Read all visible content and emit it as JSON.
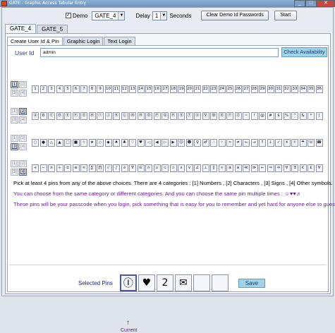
{
  "window": {
    "title": "GATE - Graphic Access Tabular Entry",
    "min": "_",
    "max": "□",
    "close": "✕"
  },
  "topbar": {
    "demo_checked": "✓",
    "demo_label": "Demo",
    "gate_value": "GATE_4",
    "delay_label": "Delay",
    "delay_value": "1",
    "seconds_label": "Seconds",
    "clear_btn": "Clear Demo Id Passwords",
    "start_btn": "Start"
  },
  "outer_tabs": [
    "GATE_4",
    "GATE_5"
  ],
  "inner_tabs": [
    "Create User Id & Pin",
    "Graphic Login",
    "Text Login"
  ],
  "form": {
    "user_id_label": "User Id",
    "user_id_value": "admin",
    "check_btn": "Check Availability"
  },
  "categories": [
    "[1]",
    "[2]",
    "[3]",
    "[4]"
  ],
  "groups": [
    {
      "selected": 0,
      "pins": [
        "1",
        "2",
        "3",
        "4",
        "5",
        "6",
        "7",
        "8",
        "9",
        "10",
        "11",
        "12",
        "13",
        "14",
        "15",
        "16",
        "17",
        "18",
        "19",
        "20",
        "21",
        "22",
        "23",
        "24",
        "25",
        "26",
        "27",
        "28",
        "29",
        "30",
        "31",
        "32",
        "33",
        "34",
        "35",
        "36"
      ]
    },
    {
      "selected": 1,
      "pins": [
        "Ⓐ",
        "Ⓑ",
        "Ⓒ",
        "Ⓓ",
        "Ⓔ",
        "Ⓕ",
        "Ⓖ",
        "Ⓗ",
        "Ⓘ",
        "Ⓙ",
        "Ⓚ",
        "Ⓛ",
        "Ⓜ",
        "Ⓝ",
        "Ⓞ",
        "Ⓟ",
        "Ⓠ",
        "Ⓡ",
        "Ⓢ",
        "Ⓣ",
        "Ⓤ",
        "Ⓥ",
        "Ⓦ",
        "Ⓧ",
        "Ⓨ",
        "Ⓩ",
        "~",
        "!",
        "@",
        "#",
        "$",
        "%",
        "^",
        "&",
        "*",
        "("
      ]
    },
    {
      "selected": 2,
      "pins": [
        "○",
        "●",
        "△",
        "▲",
        "□",
        "■",
        "☆",
        "★",
        "◇",
        "◆",
        "♠",
        "♣",
        "♡",
        "♥",
        "◁",
        "◀",
        "▷",
        "▶",
        "☺",
        "☻",
        "♀",
        "♂",
        "∴",
        "∵",
        "≈",
        "≠",
        "←",
        "→",
        "↑",
        "↓",
        "✓",
        "✕",
        "☼",
        "☂",
        "☏",
        "☎"
      ]
    },
    {
      "selected": 3,
      "pins": [
        "+",
        "−",
        "×",
        "÷",
        "±",
        "≡",
        "∞",
        "∑",
        "∏",
        "√",
        "∫",
        "∂",
        "∇",
        "∈",
        "∩",
        "∪",
        "⊂",
        "⊃",
        "∧",
        "∨",
        "∠",
        "⊥",
        "∥",
        "∝",
        "≤",
        "≥",
        "≪",
        "≫",
        "←",
        "⇒",
        "⇔",
        "∀",
        "∃",
        "€",
        "£",
        "¥"
      ]
    }
  ],
  "info_lines": [
    "Pick at least 4 pins from any of the above choices. There are 4 categories : [1] Numbers , [2] Characters , [3] Signs , [4] Other symbols.",
    "You can choose from the same category or different categories. And you can choose the same pin multiple times : ☺♥♥♬",
    "These pins will be your passcode when you login, pick something that is easy for you to remember and yet hard for anyone else to guess."
  ],
  "selected_pins": {
    "label": "Selected Pins",
    "slots": [
      "Ⓘ",
      "♥",
      "2",
      "✉",
      "",
      ""
    ],
    "save_btn": "Save",
    "current_arrow": "↑",
    "current_label": "Current"
  }
}
